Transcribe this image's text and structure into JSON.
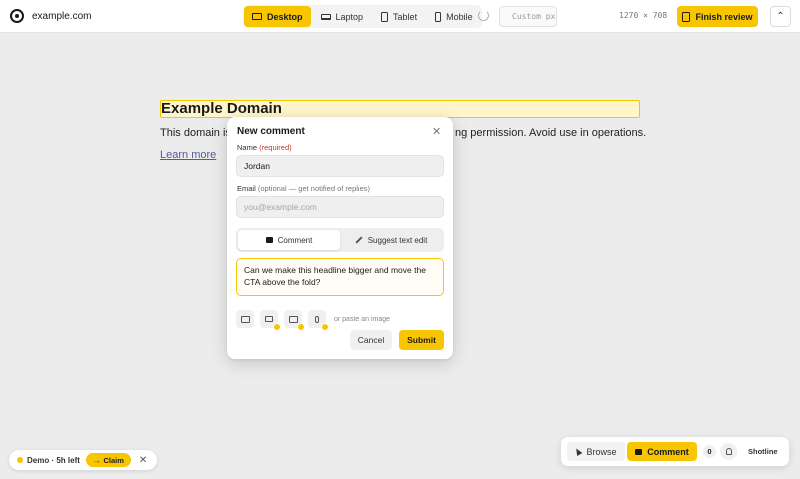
{
  "topbar": {
    "site_name": "example.com",
    "devices": [
      {
        "label": "Desktop",
        "active": true
      },
      {
        "label": "Laptop",
        "active": false
      },
      {
        "label": "Tablet",
        "active": false
      },
      {
        "label": "Mobile",
        "active": false
      }
    ],
    "custom_placeholder": "Custom px",
    "dimensions": "1270 × 708",
    "finish_label": "Finish review"
  },
  "page": {
    "heading": "Example Domain",
    "para_start": "This domain is",
    "para_end": "ng permission. Avoid use in operations.",
    "link": "Learn more"
  },
  "modal": {
    "title": "New comment",
    "name_label": "Name",
    "name_required": "(required)",
    "name_value": "Jordan",
    "email_label": "Email",
    "email_optional": "(optional — get notified of replies)",
    "email_placeholder": "you@example.com",
    "tab_comment": "Comment",
    "tab_suggest": "Suggest text edit",
    "comment_text": "Can we make this headline bigger and move the CTA above the fold?",
    "paste_hint": "or paste an image",
    "cancel_label": "Cancel",
    "submit_label": "Submit"
  },
  "demo": {
    "text": "Demo · 5h left",
    "claim_label": "Claim"
  },
  "modebar": {
    "browse_label": "Browse",
    "comment_label": "Comment",
    "count": "0",
    "brand": "Shotline"
  },
  "colors": {
    "accent": "#f7c600",
    "required": "#c0392b"
  }
}
